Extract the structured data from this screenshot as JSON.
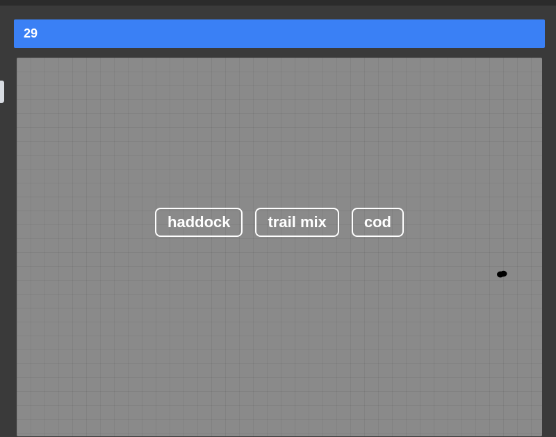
{
  "header": {
    "value": "29"
  },
  "buttons": [
    {
      "label": "haddock"
    },
    {
      "label": "trail mix"
    },
    {
      "label": "cod"
    }
  ]
}
